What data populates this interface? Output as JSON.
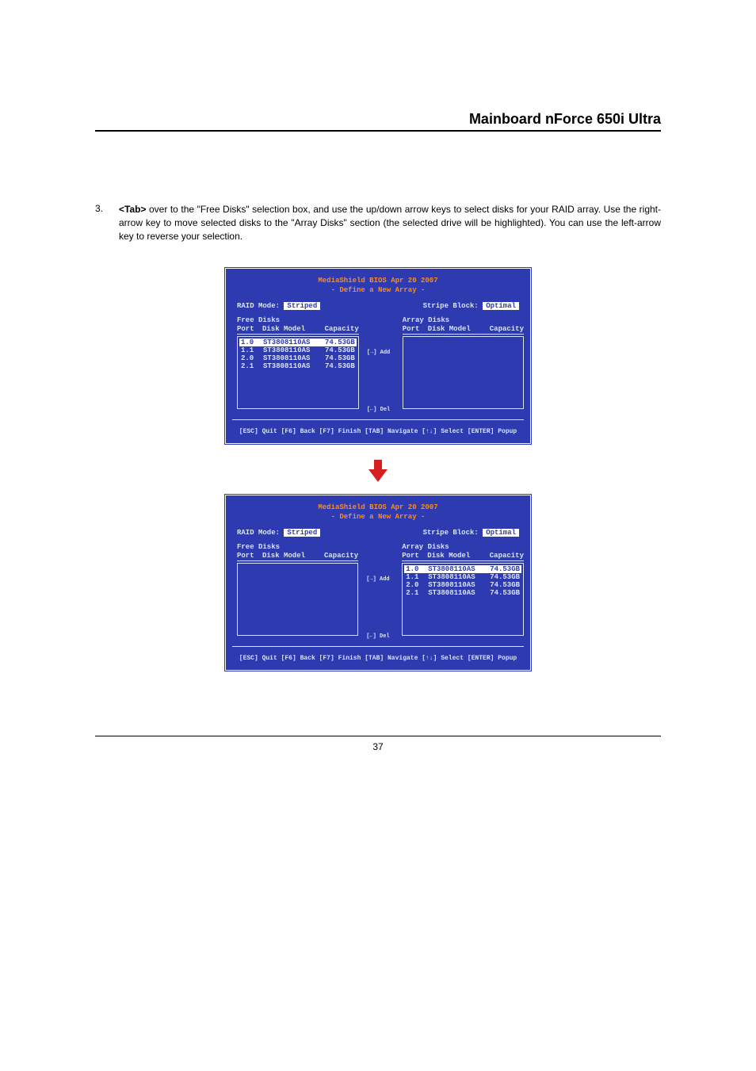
{
  "header": {
    "title": "Mainboard nForce 650i Ultra"
  },
  "instruction": {
    "number": "3.",
    "text_pre": "<Tab>",
    "text_rest": " over to the \"Free Disks\" selection box, and use the up/down arrow keys to select disks for your RAID array. Use the right-arrow key to move selected disks to the \"Array Disks\" section (the selected drive will be highlighted). You can use the left-arrow key to reverse your selection."
  },
  "bios": {
    "title": "MediaShield BIOS Apr 20 2007",
    "subtitle": "- Define a New Array -",
    "raid_mode_label": "RAID Mode:",
    "raid_mode_value": "Striped",
    "stripe_block_label": "Stripe Block:",
    "stripe_block_value": "Optimal",
    "free_disks_label": "Free Disks",
    "array_disks_label": "Array Disks",
    "col_port": "Port",
    "col_model": "Disk Model",
    "col_capacity": "Capacity",
    "add_hint": "[→] Add",
    "del_hint": "[←] Del",
    "footer": "[ESC] Quit [F6] Back [F7] Finish [TAB] Navigate [↑↓] Select [ENTER] Popup"
  },
  "disks": [
    {
      "port": "1.0",
      "model": "ST3808110AS",
      "capacity": "74.53GB"
    },
    {
      "port": "1.1",
      "model": "ST3808110AS",
      "capacity": "74.53GB"
    },
    {
      "port": "2.0",
      "model": "ST3808110AS",
      "capacity": "74.53GB"
    },
    {
      "port": "2.1",
      "model": "ST3808110AS",
      "capacity": "74.53GB"
    }
  ],
  "page_number": "37"
}
